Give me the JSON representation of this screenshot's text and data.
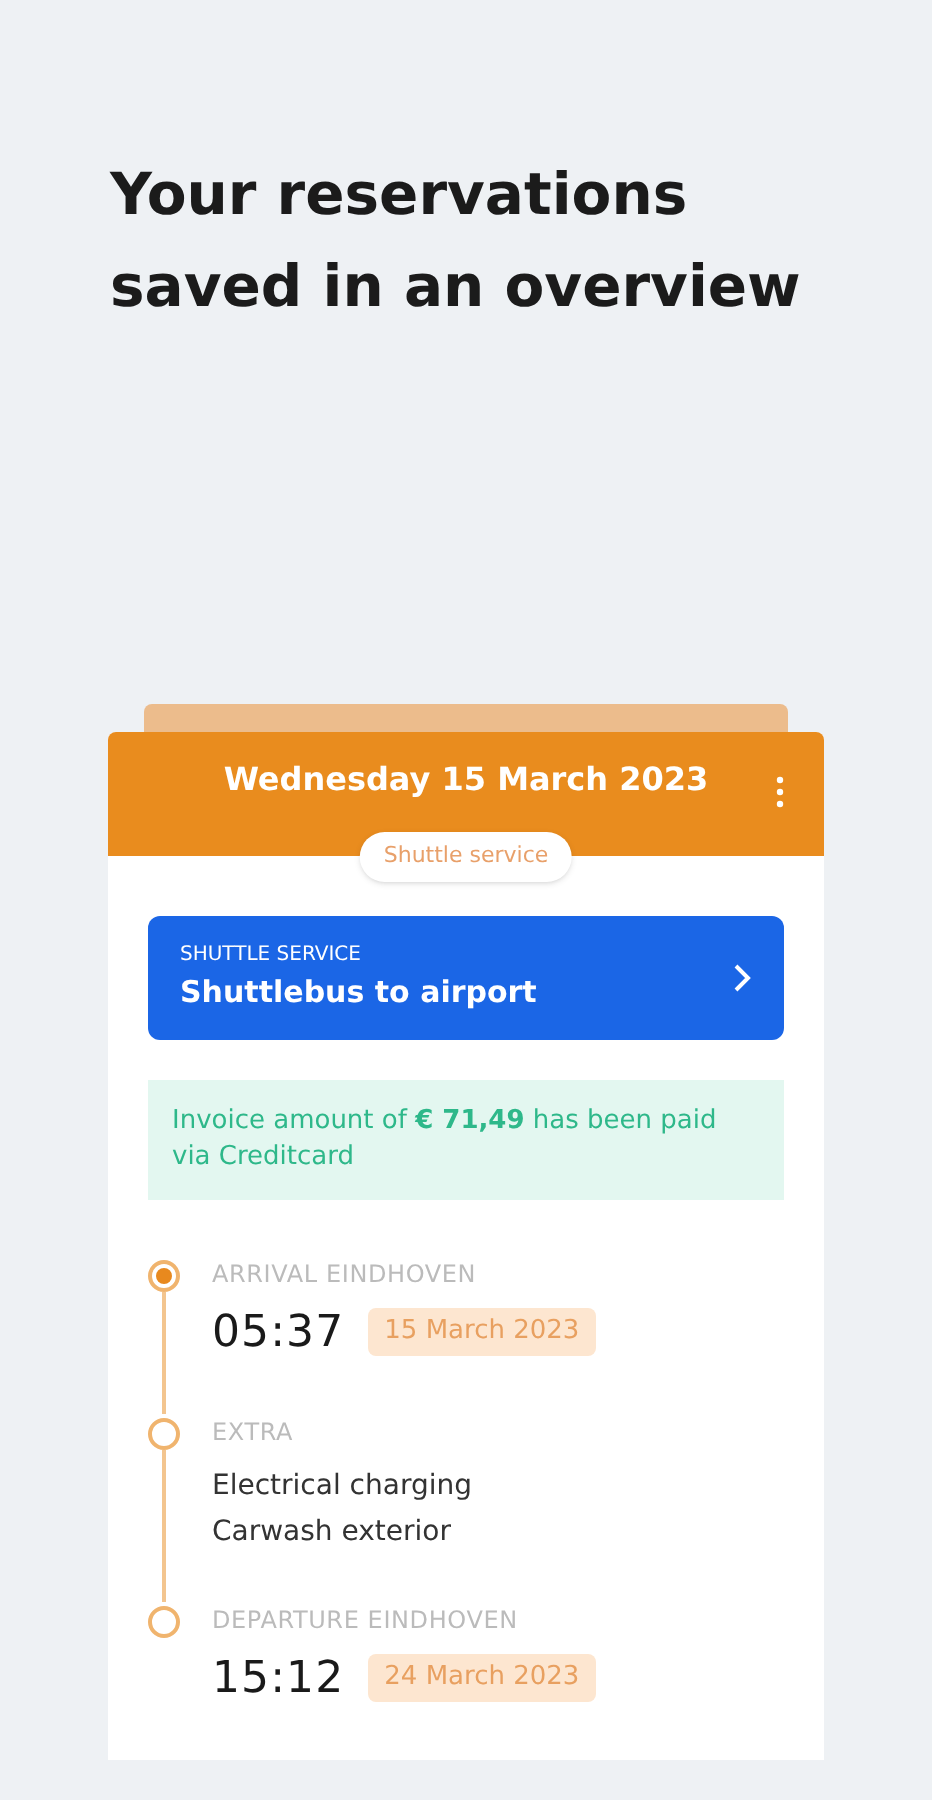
{
  "headline": "Your reservations saved in an overview",
  "card": {
    "date": "Wednesday 15 March 2023",
    "tag": "Shuttle service"
  },
  "service": {
    "category": "SHUTTLE SERVICE",
    "title": "Shuttlebus to airport"
  },
  "notice": "Invoice amount of **€ 71,49** has been paid via Creditcard",
  "timeline": [
    {
      "kind": "time",
      "label": "ARRIVAL EINDHOVEN",
      "active": true,
      "time": "05:37",
      "date": "15 March 2023"
    },
    {
      "kind": "list",
      "label": "EXTRA",
      "active": false,
      "items": [
        "Electrical charging",
        "Carwash exterior"
      ]
    },
    {
      "kind": "time",
      "label": "DEPARTURE EINDHOVEN",
      "active": false,
      "time": "15:12",
      "date": "24 March 2023"
    }
  ]
}
